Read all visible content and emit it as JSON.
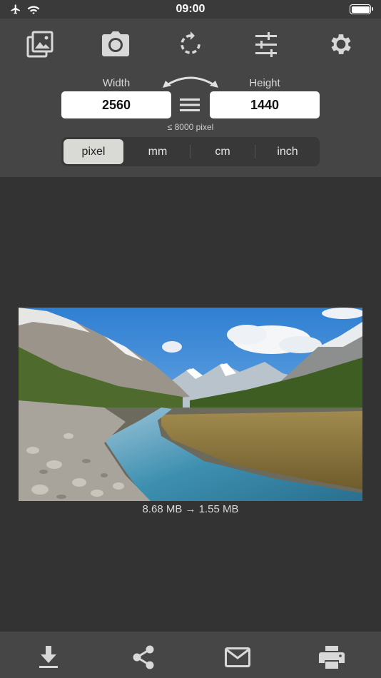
{
  "status_bar": {
    "time": "09:00",
    "icons": [
      "airplane-icon",
      "wifi-icon",
      "battery-icon"
    ]
  },
  "toolbar": {
    "items": [
      "photo-library-icon",
      "camera-icon",
      "rotate-icon",
      "sliders-icon",
      "gear-icon"
    ]
  },
  "dimensions": {
    "width_label": "Width",
    "height_label": "Height",
    "width_value": "2560",
    "height_value": "1440",
    "limit_note": "≤ 8000 pixel",
    "swap_icon": "swap-arrows-icon",
    "link_icon": "equals-lock-icon"
  },
  "units": {
    "options": [
      "pixel",
      "mm",
      "cm",
      "inch"
    ],
    "selected": "pixel"
  },
  "image": {
    "description_icon": "landscape-photo",
    "size_info": "8.68 MB  →  1.55 MB"
  },
  "bottom_bar": {
    "items": [
      "download-icon",
      "share-icon",
      "mail-icon",
      "print-icon"
    ]
  },
  "colors": {
    "background": "#333333",
    "panel": "#454545",
    "bottom_bar": "#464646",
    "segment_active": "#d9d9d6"
  }
}
